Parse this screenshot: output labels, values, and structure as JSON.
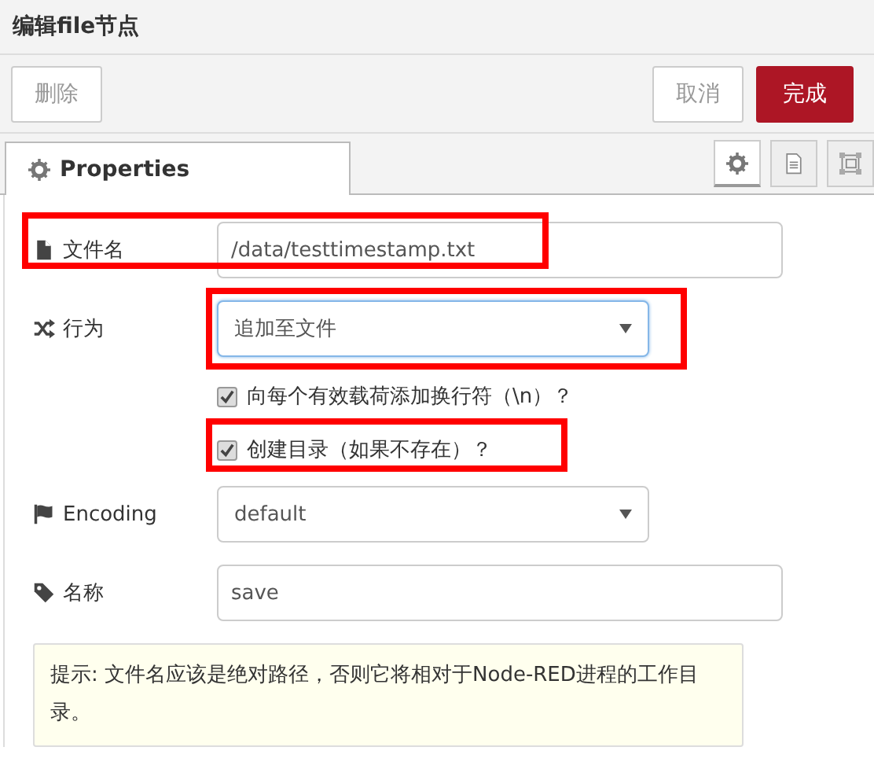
{
  "window": {
    "title": "编辑file节点"
  },
  "toolbar": {
    "buttons": [
      {
        "label": "删除",
        "kind": "plain"
      },
      {
        "label": "取消",
        "kind": "plain"
      },
      {
        "label": "完成",
        "kind": "primary"
      }
    ]
  },
  "tabs": [
    {
      "label": "Properties",
      "selected": true
    }
  ],
  "tab_tools": [
    {
      "selected": true
    },
    {
      "selected": false
    },
    {
      "selected": false
    }
  ],
  "fields": [
    {
      "kind": "text",
      "label": "文件名",
      "value": "/data/testtimestamp.txt",
      "highlighted": true
    },
    {
      "kind": "select",
      "label": "行为",
      "value": "追加至文件",
      "focused": true,
      "highlighted": true
    },
    {
      "kind": "checkbox",
      "label": "向每个有效载荷添加换行符（\\n）？",
      "checked": true,
      "highlighted": false
    },
    {
      "kind": "checkbox",
      "label": "创建目录（如果不存在）？",
      "checked": true,
      "highlighted": true
    },
    {
      "kind": "select",
      "label": "Encoding",
      "value": "default",
      "focused": false,
      "highlighted": false
    },
    {
      "kind": "text",
      "label": "名称",
      "value": "save",
      "highlighted": false
    }
  ],
  "tip": "提示: 文件名应该是绝对路径，否则它将相对于Node-RED进程的工作目录。"
}
